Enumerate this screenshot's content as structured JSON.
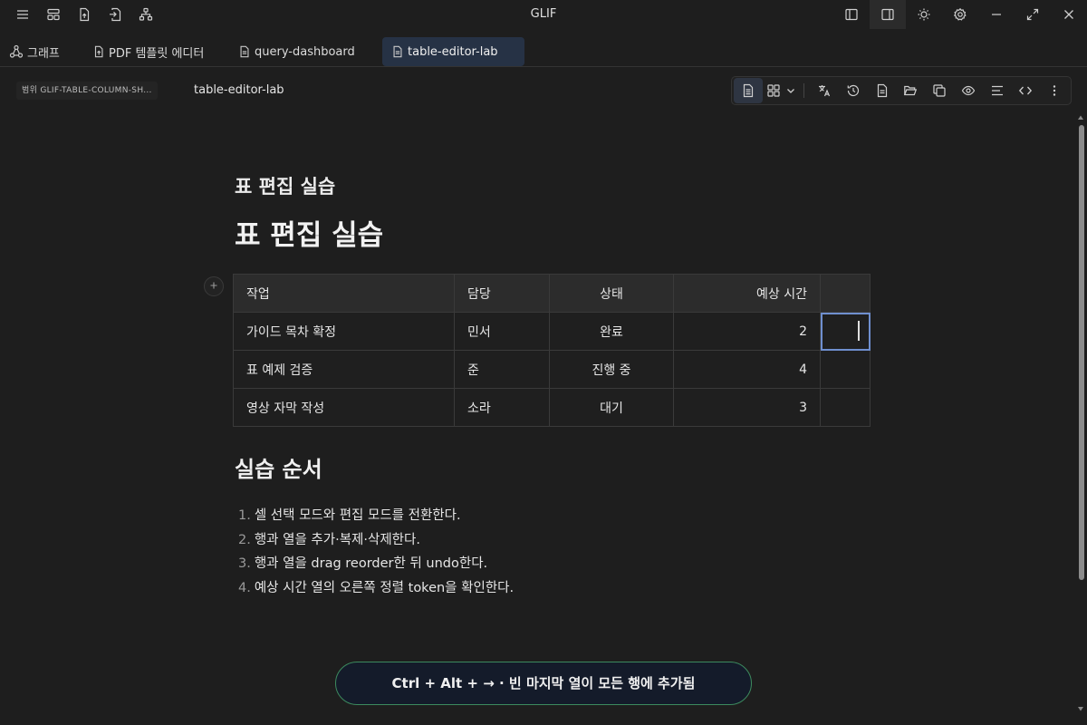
{
  "app": {
    "title": "GLIF"
  },
  "titlebar": {
    "left_icons": [
      "menu-icon",
      "layout-icon",
      "file-upload-icon",
      "file-export-icon",
      "sitemap-icon"
    ],
    "right_icons": [
      "sidebar-left-icon",
      "sidebar-right-icon",
      "sun-icon",
      "gear-icon",
      "minimize-icon",
      "maximize-icon",
      "close-icon"
    ]
  },
  "tabs": [
    {
      "label": "그래프",
      "icon": "graph-icon",
      "active": false
    },
    {
      "label": "PDF 템플릿 에디터",
      "icon": "file-upload-icon",
      "active": false
    },
    {
      "label": "query-dashboard",
      "icon": "document-icon",
      "active": false
    },
    {
      "label": "table-editor-lab",
      "icon": "document-icon",
      "active": true
    }
  ],
  "breadcrumb": {
    "scope": "범위 GLIF-TABLE-COLUMN-SH...",
    "document": "table-editor-lab"
  },
  "toolbar": {
    "icons": [
      "document-view-icon",
      "grid-view-icon",
      "chevron-down-icon",
      "translate-icon",
      "history-icon",
      "page-icon",
      "folder-open-icon",
      "copy-icon",
      "eye-icon",
      "align-icon",
      "code-icon",
      "more-icon"
    ]
  },
  "document": {
    "meta_title": "표 편집 실습",
    "heading": "표 편집 실습",
    "table": {
      "headers": [
        "작업",
        "담당",
        "상태",
        "예상 시간",
        ""
      ],
      "rows": [
        [
          "가이드 목차 확정",
          "민서",
          "완료",
          "2",
          ""
        ],
        [
          "표 예제 검증",
          "준",
          "진행 중",
          "4",
          ""
        ],
        [
          "영상 자막 작성",
          "소라",
          "대기",
          "3",
          ""
        ]
      ]
    },
    "section_heading": "실습 순서",
    "steps": [
      {
        "num": "1.",
        "text": "셀 선택 모드와 편집 모드를 전환한다."
      },
      {
        "num": "2.",
        "text": "행과 열을 추가·복제·삭제한다."
      },
      {
        "num": "3.",
        "text": "행과 열을 drag reorder한 뒤 undo한다."
      },
      {
        "num": "4.",
        "text": "예상 시간 열의 오른쪽 정렬 token을 확인한다."
      }
    ]
  },
  "toast": {
    "text": "Ctrl + Alt + → · 빈 마지막 열이 모든 행에 추가됨"
  },
  "colors": {
    "accent": "#6f8fcf",
    "toast_border": "#3c8a5e",
    "active_tab": "#263245"
  }
}
